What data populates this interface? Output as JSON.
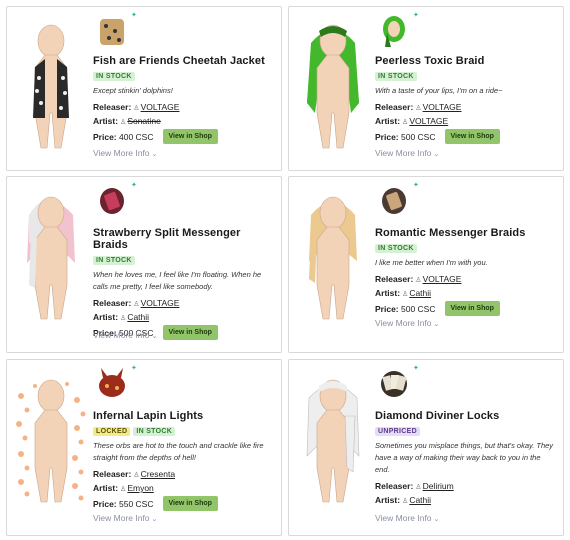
{
  "items": [
    {
      "title": "Fish are Friends Cheetah Jacket",
      "badges": [
        "IN STOCK"
      ],
      "description": "Except stinkin' dolphins!",
      "releaser_label": "Releaser:",
      "releaser": "VOLTAGE",
      "artist_label": "Artist:",
      "artist": "Sonatine",
      "price_label": "Price:",
      "price": "400 CSC",
      "button": "View in Shop",
      "more": "View More Info",
      "icon": "cheetah-jacket-icon"
    },
    {
      "title": "Peerless Toxic Braid",
      "badges": [
        "IN STOCK"
      ],
      "description": "With a taste of your lips, I'm on a ride~",
      "releaser_label": "Releaser:",
      "releaser": "VOLTAGE",
      "artist_label": "Artist:",
      "artist": "VOLTAGE",
      "price_label": "Price:",
      "price": "500 CSC",
      "button": "View in Shop",
      "more": "View More Info",
      "icon": "toxic-braid-icon"
    },
    {
      "title": "Strawberry Split Messenger Braids",
      "badges": [
        "IN STOCK"
      ],
      "description": "When he loves me, I feel like I'm floating. When he calls me pretty, I feel like somebody.",
      "releaser_label": "Releaser:",
      "releaser": "VOLTAGE",
      "artist_label": "Artist:",
      "artist": "Cathii",
      "price_label": "Price:",
      "price": "500 CSC",
      "button": "View in Shop",
      "more": "View More Info",
      "icon": "messenger-braids-icon"
    },
    {
      "title": "Romantic Messenger Braids",
      "badges": [
        "IN STOCK"
      ],
      "description": "I like me better when I'm with you.",
      "releaser_label": "Releaser:",
      "releaser": "VOLTAGE",
      "artist_label": "Artist:",
      "artist": "Cathii",
      "price_label": "Price:",
      "price": "500 CSC",
      "button": "View in Shop",
      "more": "View More Info",
      "icon": "romantic-braids-icon"
    },
    {
      "title": "Infernal Lapin Lights",
      "badges": [
        "LOCKED",
        "IN STOCK"
      ],
      "description": "These orbs are hot to the touch and crackle like fire straight from the depths of hell!",
      "releaser_label": "Releaser:",
      "releaser": "Cresenta",
      "artist_label": "Artist:",
      "artist": "Emyon",
      "price_label": "Price:",
      "price": "550 CSC",
      "button": "View in Shop",
      "more": "View More Info",
      "icon": "lapin-lights-icon"
    },
    {
      "title": "Diamond Diviner Locks",
      "badges": [
        "UNPRICED"
      ],
      "description": "Sometimes you misplace things, but that's okay. They have a way of making their way back to you in the end.",
      "releaser_label": "Releaser:",
      "releaser": "Delirium",
      "artist_label": "Artist:",
      "artist": "Cathii",
      "more": "View More Info",
      "icon": "diviner-locks-icon"
    }
  ],
  "colors": {
    "skin": "#f3d3b8",
    "in_stock_bg": "#d6f0d3",
    "locked_bg": "#f4ea8c",
    "unpriced_bg": "#e7dcf6",
    "button_bg": "#92c46a"
  }
}
